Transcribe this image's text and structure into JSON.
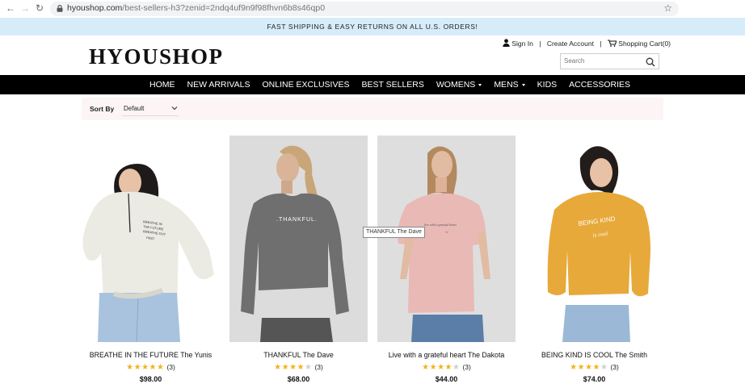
{
  "browser": {
    "url_host": "hyoushop.com",
    "url_path": "/best-sellers-h3?zenid=2ndq4uf9n9f98fhvn6b8s46qp0"
  },
  "promo_text": "FAST SHIPPING & EASY RETURNS ON ALL U.S. ORDERS!",
  "logo": "HYOUSHOP",
  "account": {
    "sign_in": "Sign In",
    "create_account": "Create Account",
    "cart": "Shopping Cart(0)",
    "separator": "|"
  },
  "search": {
    "placeholder": "Search"
  },
  "nav": {
    "home": "HOME",
    "new_arrivals": "NEW ARRIVALS",
    "online_exclusives": "ONLINE EXCLUSIVES",
    "best_sellers": "BEST SELLERS",
    "womens": "WOMENS",
    "mens": "MENS",
    "kids": "KIDS",
    "accessories": "ACCESSORIES"
  },
  "sort": {
    "label": "Sort By",
    "value": "Default"
  },
  "products": [
    {
      "name": "BREATHE IN THE FUTURE The Yunis",
      "rating": 5,
      "reviews": "(3)",
      "price": "$98.00",
      "shirt_text": "BREATHE IN THE FUTURE"
    },
    {
      "name": "THANKFUL The Dave",
      "rating": 4,
      "reviews": "(3)",
      "price": "$68.00",
      "shirt_text": ".THANKFUL."
    },
    {
      "name": "Live with a grateful heart The Dakota",
      "rating": 4,
      "reviews": "(3)",
      "price": "$44.00",
      "shirt_text": "live with a grateful heart"
    },
    {
      "name": "BEING KIND IS COOL The Smith",
      "rating": 4,
      "reviews": "(3)",
      "price": "$74.00",
      "shirt_text": "BEING KIND is cool"
    }
  ],
  "tooltip": "THANKFUL The Dave",
  "colors": {
    "nav_bg": "#000000",
    "promo_bg": "#d6ecf8",
    "star": "#f2b31c"
  }
}
